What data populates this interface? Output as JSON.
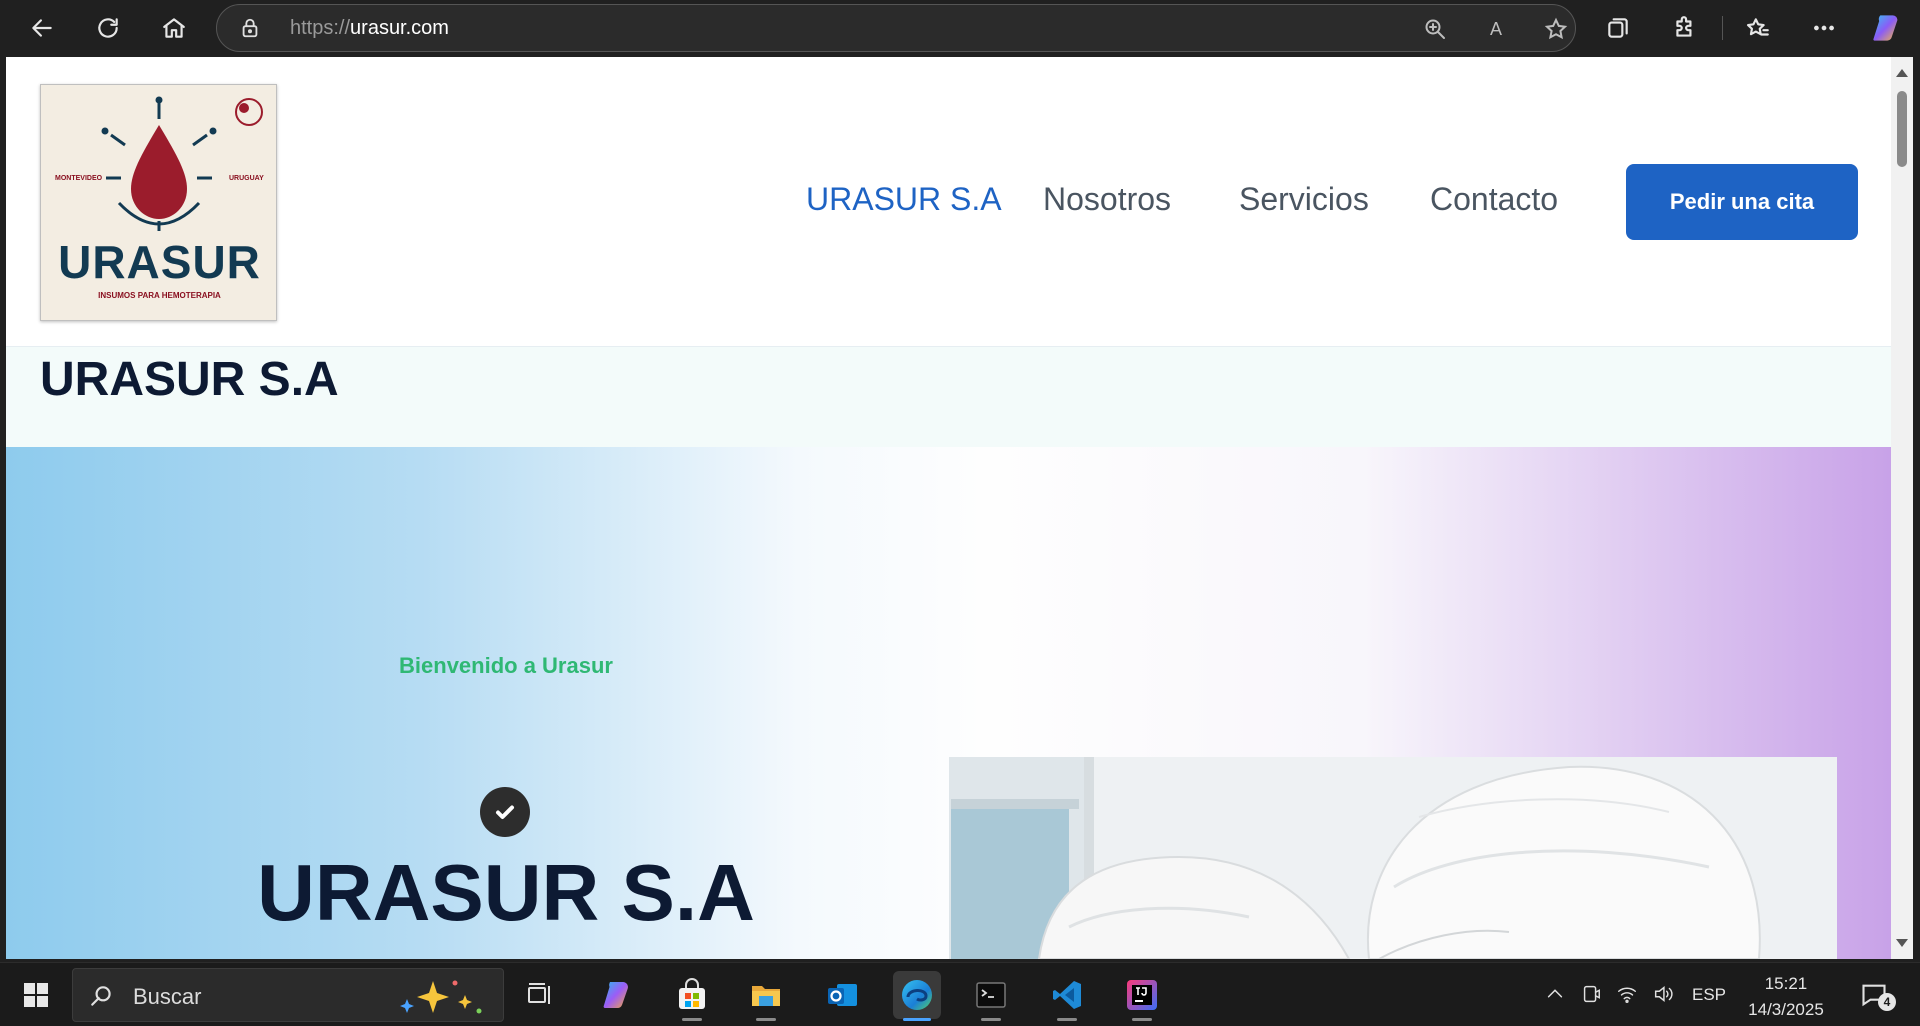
{
  "browser": {
    "url_protocol": "https://",
    "url_domain": "urasur.com",
    "icons": [
      "back-icon",
      "refresh-icon",
      "home-icon",
      "lock-icon",
      "zoom-icon",
      "read-aloud-icon",
      "favorite-star-icon",
      "collections-icon",
      "extensions-icon",
      "favorites-icon",
      "more-icon",
      "copilot-icon"
    ],
    "read_aloud_glyph": "A"
  },
  "site": {
    "logo": {
      "wordmark": "URASUR",
      "tagline": "INSUMOS PARA HEMOTERAPIA",
      "left_city": "MONTEVIDEO",
      "right_city": "URUGUAY",
      "colors": {
        "drop": "#9b1c2c",
        "text": "#123a52",
        "background": "#f3ede2"
      }
    },
    "nav": [
      {
        "label": "URASUR S.A",
        "active": true
      },
      {
        "label": "Nosotros",
        "active": false
      },
      {
        "label": "Servicios",
        "active": false
      },
      {
        "label": "Contacto",
        "active": false
      }
    ],
    "cta_label": "Pedir una cita",
    "page_title": "URASUR S.A",
    "hero": {
      "welcome": "Bienvenido a Urasur",
      "title": "URASUR S.A",
      "photo_icon": "lab-workers-photo"
    },
    "colors": {
      "accent": "#1e63c4",
      "welcome_green": "#2fb874",
      "heading": "#0d1a33"
    }
  },
  "taskbar": {
    "search_placeholder": "Buscar",
    "apps": [
      "windows-start-icon",
      "task-view-icon",
      "copilot-icon",
      "microsoft-store-icon",
      "file-explorer-icon",
      "outlook-icon",
      "edge-icon",
      "terminal-icon",
      "vscode-icon",
      "intellij-icon"
    ],
    "active_app": "edge-icon",
    "language": "ESP",
    "time": "15:21",
    "date": "14/3/2025",
    "notification_count": "4"
  }
}
